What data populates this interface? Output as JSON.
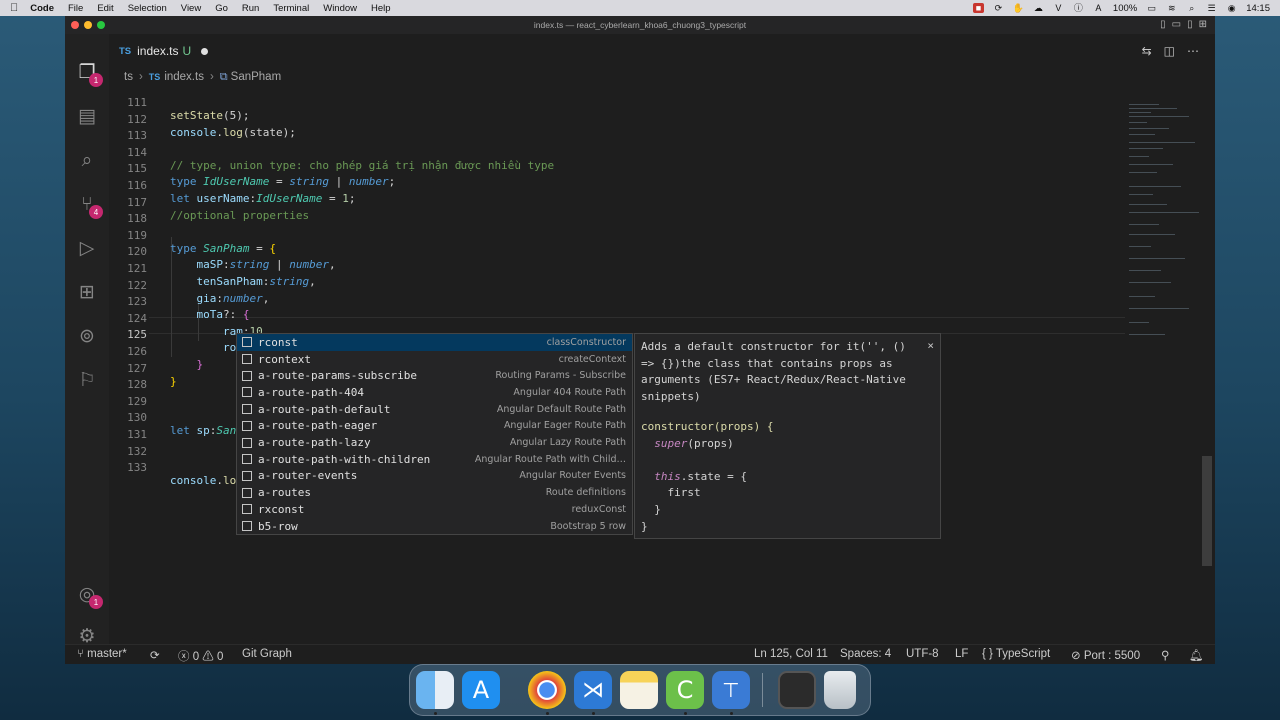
{
  "menubar": {
    "app_name": "Code",
    "items": [
      "File",
      "Edit",
      "Selection",
      "View",
      "Go",
      "Run",
      "Terminal",
      "Window",
      "Help"
    ],
    "battery": "100%",
    "clock": "14:15"
  },
  "window": {
    "title": "index.ts — react_cyberlearn_khoa6_chuong3_typescript"
  },
  "activity": {
    "explorer_badge": "1",
    "scm_badge": "4",
    "accounts_badge": "1"
  },
  "tab": {
    "lang": "TS",
    "name": "index.ts",
    "status": "U"
  },
  "breadcrumb": {
    "folder": "ts",
    "lang": "TS",
    "file": "index.ts",
    "symbol": "SanPham"
  },
  "editor": {
    "line_numbers": [
      "111",
      "112",
      "113",
      "114",
      "115",
      "116",
      "117",
      "118",
      "119",
      "120",
      "121",
      "122",
      "123",
      "124",
      "125",
      "126",
      "127",
      "128",
      "129",
      "130",
      "131",
      "132",
      "133"
    ],
    "tokens": {
      "l111_fn": "setState",
      "l111_rest": "(5);",
      "l112_obj": "console",
      "l112_dot": ".",
      "l112_fn": "log",
      "l112_rest": "(state);",
      "l114_comment": "// type, union type: cho phép giá trị nhận được nhiều type",
      "l115_kw": "type",
      "l115_name": "IdUserName",
      "l115_eq": " = ",
      "l115_t1": "string",
      "l115_bar": " | ",
      "l115_t2": "number",
      "l115_end": ";",
      "l116_kw": "let",
      "l116_var": "userName",
      "l116_colon": ":",
      "l116_type": "IdUserName",
      "l116_eq": " = ",
      "l116_num": "1",
      "l116_end": ";",
      "l117_comment": "//optional properties",
      "l119_kw": "type",
      "l119_name": "SanPham",
      "l119_eq": " = ",
      "l119_brace": "{",
      "l120_prop": "maSP",
      "l120_colon": ":",
      "l120_t1": "string",
      "l120_bar": " | ",
      "l120_t2": "number",
      "l120_end": ",",
      "l121_prop": "tenSanPham",
      "l121_colon": ":",
      "l121_t": "string",
      "l121_end": ",",
      "l122_prop": "gia",
      "l122_colon": ":",
      "l122_t": "number",
      "l122_end": ",",
      "l123_prop": "moTa",
      "l123_opt": "?: ",
      "l123_brace": "{",
      "l124_prop": "ram",
      "l124_colon": ":",
      "l124_num": "10",
      "l124_end": ",",
      "l125_typed": "ro",
      "l126_brace": "}",
      "l127_brace": "}",
      "l130_kw": "let",
      "l130_var": "sp",
      "l130_colon": ":",
      "l130_type": "San",
      "l133_obj": "console",
      "l133_dot": ".",
      "l133_fn": "lo"
    }
  },
  "suggestions": [
    {
      "label": "rconst",
      "detail": "classConstructor"
    },
    {
      "label": "rcontext",
      "detail": "createContext"
    },
    {
      "label": "a-route-params-subscribe",
      "detail": "Routing Params - Subscribe"
    },
    {
      "label": "a-route-path-404",
      "detail": "Angular 404 Route Path"
    },
    {
      "label": "a-route-path-default",
      "detail": "Angular Default Route Path"
    },
    {
      "label": "a-route-path-eager",
      "detail": "Angular Eager Route Path"
    },
    {
      "label": "a-route-path-lazy",
      "detail": "Angular Lazy Route Path"
    },
    {
      "label": "a-route-path-with-children",
      "detail": "Angular Route Path with Child…"
    },
    {
      "label": "a-router-events",
      "detail": "Angular Router Events"
    },
    {
      "label": "a-routes",
      "detail": "Route definitions"
    },
    {
      "label": "rxconst",
      "detail": "reduxConst"
    },
    {
      "label": "b5-row",
      "detail": "Bootstrap 5 row"
    }
  ],
  "docs": {
    "description": "Adds a default constructor for it('', () => {})the class that contains props as arguments (ES7+ React/Redux/React-Native snippets)",
    "close": "×",
    "snippet": {
      "l1": "constructor(props) {",
      "l2_kw": "super",
      "l2_rest": "(props)",
      "l4_kw": "this",
      "l4_rest": ".state = {",
      "l5": "first",
      "l6": "}",
      "l7": "}"
    }
  },
  "statusbar": {
    "branch": "master*",
    "errors": "0",
    "warnings": "0",
    "git_graph": "Git Graph",
    "position": "Ln 125, Col 11",
    "spaces": "Spaces: 4",
    "encoding": "UTF-8",
    "eol": "LF",
    "language": "TypeScript",
    "port": "Port : 5500"
  }
}
